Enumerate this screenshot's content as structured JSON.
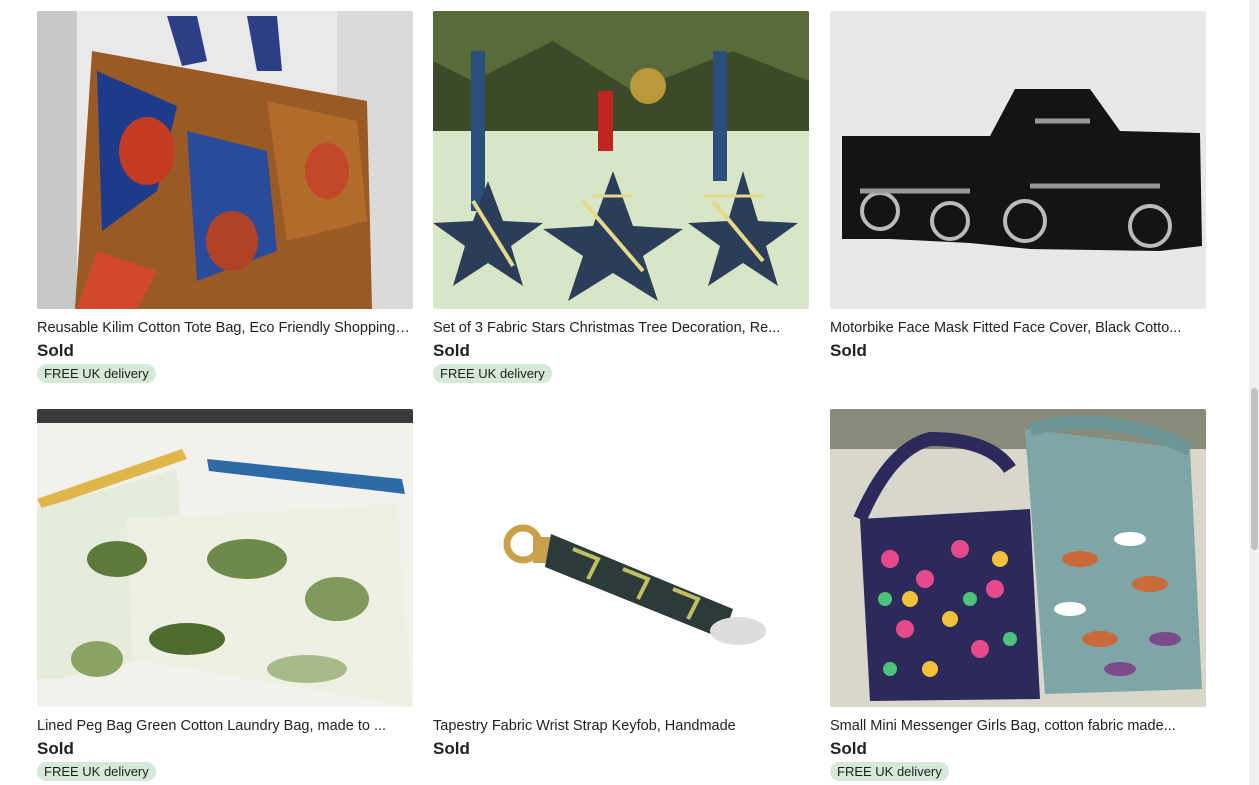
{
  "listings": [
    {
      "title": "Reusable Kilim Cotton Tote Bag, Eco Friendly Shopping Bag",
      "price": "Sold",
      "badge": "FREE UK delivery",
      "image": "kilim-tote-bag-photo"
    },
    {
      "title": "Set of 3 Fabric Stars Christmas Tree Decoration, Re...",
      "price": "Sold",
      "badge": "FREE UK delivery",
      "image": "fabric-stars-photo"
    },
    {
      "title": "Motorbike Face Mask Fitted Face Cover, Black Cotto...",
      "price": "Sold",
      "badge": "",
      "image": "motorbike-mask-photo"
    },
    {
      "title": "Lined Peg Bag Green Cotton Laundry Bag, made to ...",
      "price": "Sold",
      "badge": "FREE UK delivery",
      "image": "peg-bag-photo"
    },
    {
      "title": "Tapestry Fabric Wrist Strap Keyfob, Handmade",
      "price": "Sold",
      "badge": "",
      "image": "keyfob-photo"
    },
    {
      "title": "Small Mini Messenger Girls Bag, cotton fabric made...",
      "price": "Sold",
      "badge": "FREE UK delivery",
      "image": "messenger-bag-photo"
    }
  ],
  "colors": {
    "badge_bg": "#d4e9d7",
    "text": "#222222"
  }
}
